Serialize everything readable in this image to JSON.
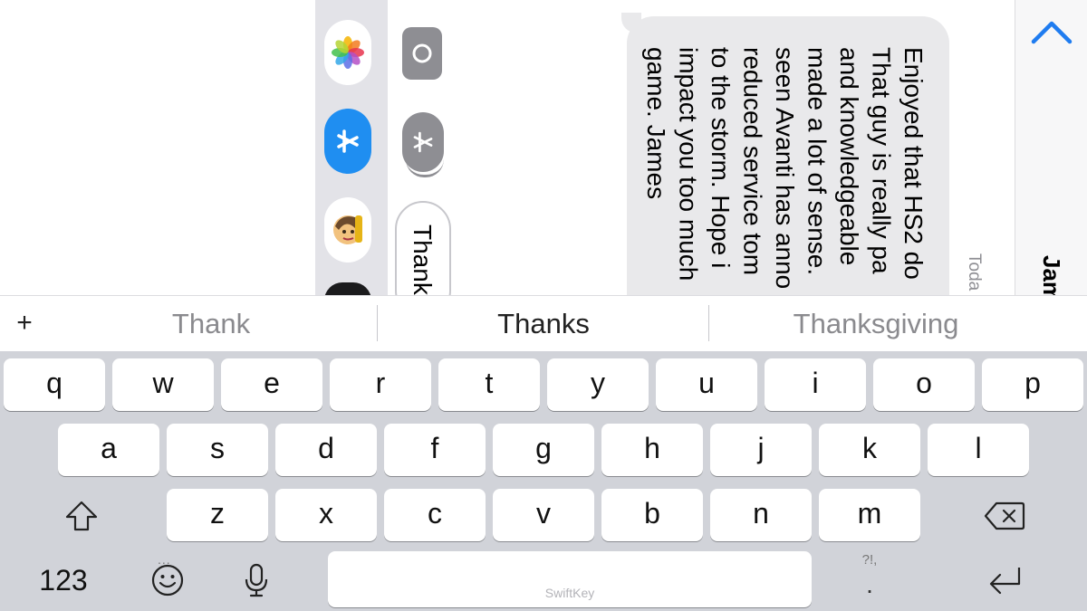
{
  "conversation": {
    "contact_name": "Jam",
    "timestamp": "Toda",
    "message_text": "Enjoyed that HS2 do\nThat guy is really pa\nand knowledgeable\nmade a lot of sense.\nseen Avanti has anno\nreduced service tom\nto the storm. Hope i\nimpact you too much\ngame. James",
    "draft_text": "Thank"
  },
  "app_drawer": {
    "items": [
      "photos-icon",
      "app-store-icon",
      "memoji-icon",
      "black-app-icon"
    ]
  },
  "composer": {
    "camera_icon": "camera-icon",
    "apps_icon": "app-store-icon"
  },
  "suggestions": {
    "items": [
      "Thank",
      "Thanks",
      "Thanksgiving"
    ]
  },
  "keyboard": {
    "row1": [
      "q",
      "w",
      "e",
      "r",
      "t",
      "y",
      "u",
      "i",
      "o",
      "p"
    ],
    "row2": [
      "a",
      "s",
      "d",
      "f",
      "g",
      "h",
      "j",
      "k",
      "l"
    ],
    "row3": [
      "z",
      "x",
      "c",
      "v",
      "b",
      "n",
      "m"
    ],
    "numbers_label": "123",
    "emoji_dots": "...",
    "space_brand": "SwiftKey",
    "punct_hint": "?!,",
    "punct_main": "."
  },
  "colors": {
    "accent": "#1f7cf0",
    "keyboard_bg": "#d1d3d9",
    "bubble_bg": "#e9e9eb"
  }
}
